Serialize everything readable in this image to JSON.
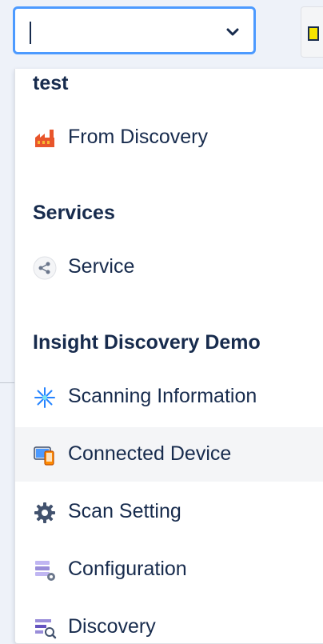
{
  "select": {
    "value": "",
    "chevron_icon": "chevron-down-icon"
  },
  "menu": {
    "groups": [
      {
        "title": "test",
        "items": [
          {
            "label": "From Discovery",
            "icon": "factory-icon"
          }
        ]
      },
      {
        "title": "Services",
        "items": [
          {
            "label": "Service",
            "icon": "share-nodes-icon"
          }
        ]
      },
      {
        "title": "Insight Discovery Demo",
        "items": [
          {
            "label": "Scanning Information",
            "icon": "starburst-icon"
          },
          {
            "label": "Connected Device",
            "icon": "devices-icon",
            "highlighted": true
          },
          {
            "label": "Scan Setting",
            "icon": "gear-icon"
          },
          {
            "label": "Configuration",
            "icon": "config-stack-icon"
          },
          {
            "label": "Discovery",
            "icon": "search-list-icon"
          }
        ]
      }
    ]
  },
  "colors": {
    "focus_border": "#4c9aff",
    "text": "#172b4d",
    "highlight_bg": "#f4f5f7",
    "page_bg": "#eef2f9"
  }
}
